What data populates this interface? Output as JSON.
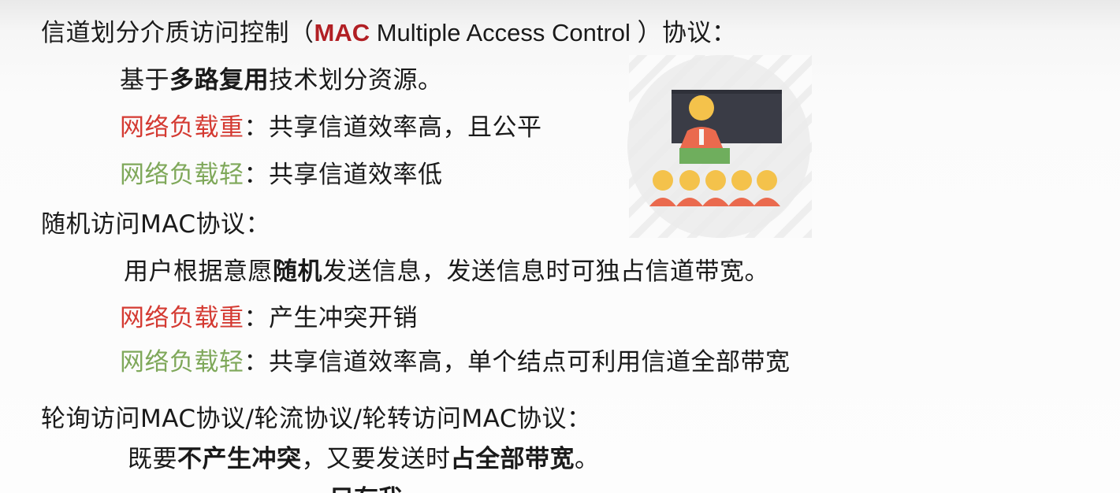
{
  "lines": {
    "l1": {
      "pre": "信道划分介质访问控制（",
      "mac": "MAC",
      "eng": " Multiple Access Control ",
      "post": "）协议："
    },
    "l2": {
      "pre": "基于",
      "bold": "多路复用",
      "post": "技术划分资源。"
    },
    "l3": {
      "label": "网络负载重",
      "text": "：共享信道效率高，且公平"
    },
    "l4": {
      "label": "网络负载轻",
      "text": "：共享信道效率低"
    },
    "l5": {
      "text": "随机访问MAC协议："
    },
    "l6": {
      "pre": "用户根据意愿",
      "bold": "随机",
      "post": "发送信息，发送信息时可独占信道带宽。"
    },
    "l7": {
      "label": "网络负载重",
      "text": "：产生冲突开销"
    },
    "l8": {
      "label": "网络负载轻",
      "text": "：共享信道效率高，单个结点可利用信道全部带宽"
    },
    "l9": {
      "text": "轮询访问MAC协议/轮流协议/轮转访问MAC协议："
    },
    "l10": {
      "pre": "既要",
      "bold1": "不产生冲突",
      "mid": "，又要发送时",
      "bold2": "占全部带宽",
      "post": "。"
    },
    "cut": {
      "text": "只有我"
    }
  },
  "colors": {
    "mac": "#b11f24",
    "heavy_load": "#d43a32",
    "light_load": "#7fa85a"
  },
  "illustration": {
    "icon": "classroom-presentation-icon"
  }
}
